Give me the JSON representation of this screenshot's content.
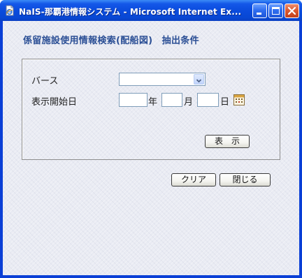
{
  "window": {
    "title": "NaIS-那覇港情報システム - Microsoft Internet Ex...",
    "icons": {
      "app": "ie-page-icon",
      "minimize": "minimize-icon",
      "maximize": "maximize-icon",
      "close": "close-icon"
    },
    "colors": {
      "titlebar": "#0a4bdc",
      "close_button": "#dd5a30",
      "background": "#e9ebf3",
      "heading": "#2b4f95"
    }
  },
  "page": {
    "heading": "係留施設使用情報検索(配船図)　抽出条件"
  },
  "form": {
    "berth_label": "バース",
    "berth_selected": "",
    "start_date_label": "表示開始日",
    "year_value": "",
    "year_unit": "年",
    "month_value": "",
    "month_unit": "月",
    "day_value": "",
    "day_unit": "日",
    "calendar_icon": "calendar-icon",
    "display_button": "表　示"
  },
  "footer": {
    "clear_button": "クリア",
    "close_button": "閉じる"
  }
}
